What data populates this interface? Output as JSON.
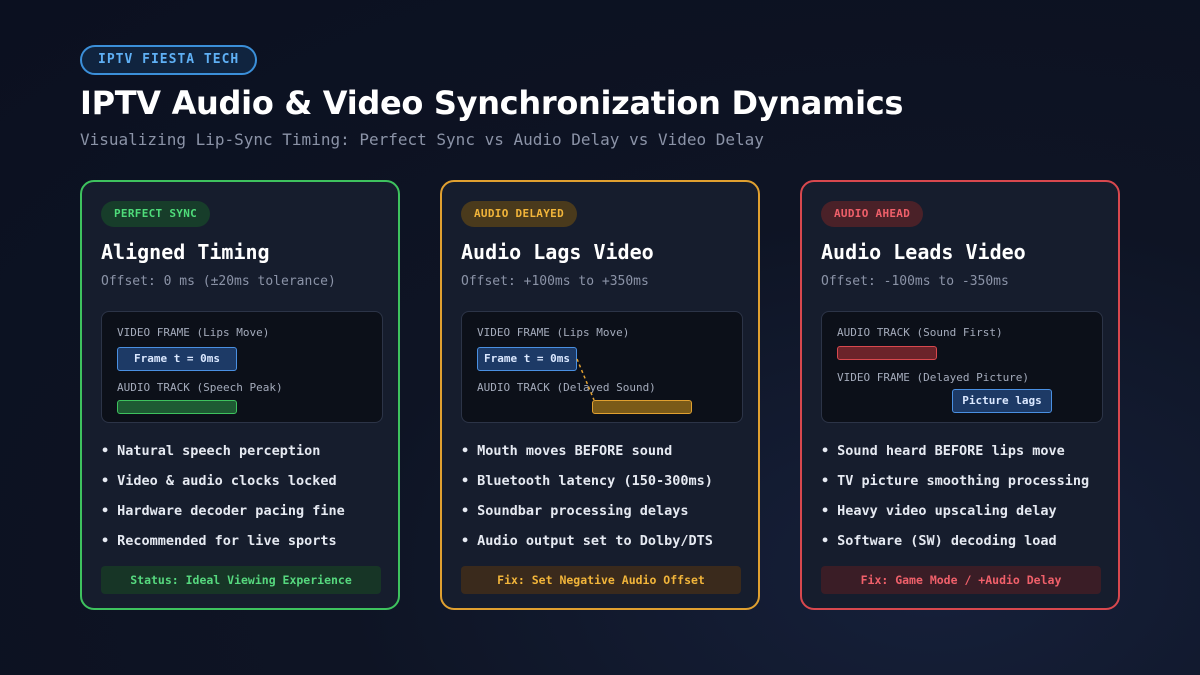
{
  "brand": "IPTV FIESTA TECH",
  "title": "IPTV Audio & Video Synchronization Dynamics",
  "subtitle": "Visualizing Lip-Sync Timing: Perfect Sync vs Audio Delay vs Video Delay",
  "colors": {
    "green": "#3ec25e",
    "amber": "#e0a030",
    "red": "#d8484e",
    "frame_blue": "#4a90e2"
  },
  "cards": [
    {
      "badge": "PERFECT SYNC",
      "title": "Aligned Timing",
      "offset": "Offset: 0 ms (±20ms tolerance)",
      "viz": {
        "top_label": "VIDEO FRAME (Lips Move)",
        "frame_label": "Frame t = 0ms",
        "bottom_label": "AUDIO TRACK (Speech Peak)"
      },
      "bullets": [
        "Natural speech perception",
        "Video & audio clocks locked",
        "Hardware decoder pacing fine",
        "Recommended for live sports"
      ],
      "status": "Status: Ideal Viewing Experience"
    },
    {
      "badge": "AUDIO DELAYED",
      "title": "Audio Lags Video",
      "offset": "Offset: +100ms to +350ms",
      "viz": {
        "top_label": "VIDEO FRAME (Lips Move)",
        "frame_label": "Frame t = 0ms",
        "bottom_label": "AUDIO TRACK (Delayed Sound)"
      },
      "bullets": [
        "Mouth moves BEFORE sound",
        "Bluetooth latency (150-300ms)",
        "Soundbar processing delays",
        "Audio output set to Dolby/DTS"
      ],
      "status": "Fix: Set Negative Audio Offset"
    },
    {
      "badge": "AUDIO AHEAD",
      "title": "Audio Leads Video",
      "offset": "Offset: -100ms to -350ms",
      "viz": {
        "top_label": "AUDIO TRACK (Sound First)",
        "bottom_label": "VIDEO FRAME (Delayed Picture)",
        "frame_label": "Picture lags"
      },
      "bullets": [
        "Sound heard BEFORE lips move",
        "TV picture smoothing processing",
        "Heavy video upscaling delay",
        "Software (SW) decoding load"
      ],
      "status": "Fix: Game Mode / +Audio Delay"
    }
  ]
}
